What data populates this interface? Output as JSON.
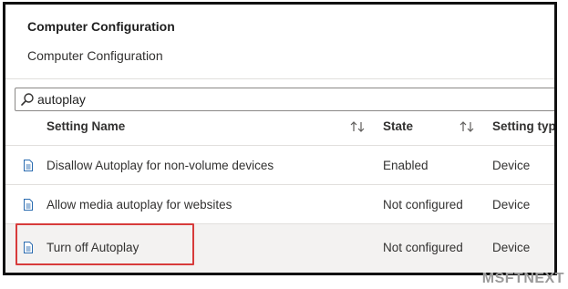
{
  "panel": {
    "title": "Computer Configuration",
    "subtitle": "Computer Configuration"
  },
  "search": {
    "value": "autoplay"
  },
  "columns": {
    "setting_name": "Setting Name",
    "state": "State",
    "setting_type": "Setting type"
  },
  "rows": [
    {
      "name": "Disallow Autoplay for non-volume devices",
      "state": "Enabled",
      "type": "Device"
    },
    {
      "name": "Allow media autoplay for websites",
      "state": "Not configured",
      "type": "Device"
    },
    {
      "name": "Turn off Autoplay",
      "state": "Not configured",
      "type": "Device"
    }
  ],
  "watermark": "MSFTNEXT",
  "colors": {
    "highlight_border": "#d73b3b",
    "selected_row": "#f3f2f1",
    "doc_icon": "#2b6cb0"
  }
}
